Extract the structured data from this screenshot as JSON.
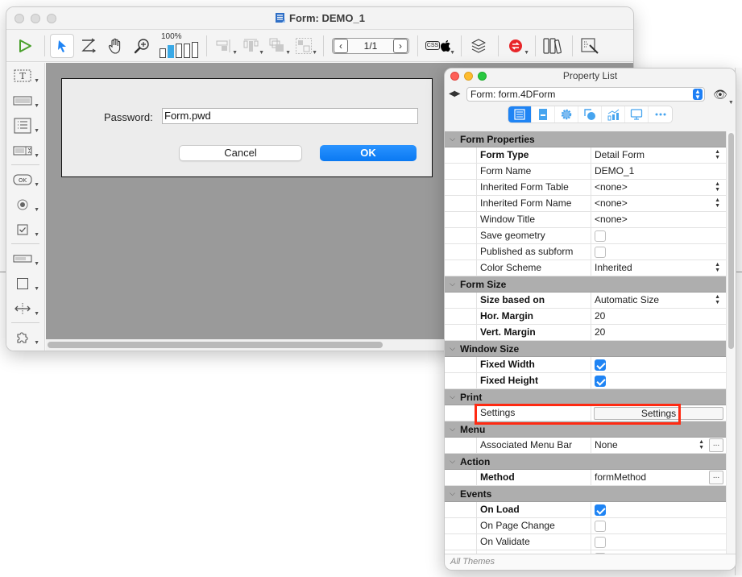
{
  "form_window": {
    "title": "Form: DEMO_1",
    "toolbar": {
      "zoom_label": "100%",
      "zoom_levels": 5,
      "zoom_active_index": 1,
      "page_indicator": "1/1",
      "css_badge": "CSS",
      "items": [
        {
          "name": "run-form",
          "icon": "play-icon"
        },
        {
          "name": "select-tool",
          "icon": "arrow-pointer-icon",
          "selected": true
        },
        {
          "name": "entry-order",
          "icon": "entry-order-icon"
        },
        {
          "name": "move-hand",
          "icon": "hand-icon"
        },
        {
          "name": "zoom-tool",
          "icon": "magnifier-plus-icon"
        },
        {
          "name": "align",
          "icon": "align-icon"
        },
        {
          "name": "distribute",
          "icon": "distribute-icon"
        },
        {
          "name": "level",
          "icon": "layer-order-icon"
        },
        {
          "name": "group",
          "icon": "group-icon"
        },
        {
          "name": "css-preview",
          "icon": "css-apple-icon"
        },
        {
          "name": "views",
          "icon": "layers-icon"
        },
        {
          "name": "shields",
          "icon": "shield-swap-icon"
        },
        {
          "name": "library",
          "icon": "library-icon"
        },
        {
          "name": "form-wizard",
          "icon": "wizard-icon"
        }
      ]
    },
    "palette": [
      {
        "name": "text",
        "icon": "text-tool-icon"
      },
      {
        "name": "input",
        "icon": "input-tool-icon"
      },
      {
        "name": "list",
        "icon": "list-tool-icon"
      },
      {
        "name": "combo",
        "icon": "combo-tool-icon"
      },
      {
        "name": "button",
        "icon": "button-tool-icon",
        "label": "OK"
      },
      {
        "name": "radio",
        "icon": "radio-tool-icon"
      },
      {
        "name": "checkbox",
        "icon": "checkbox-tool-icon"
      },
      {
        "name": "progress",
        "icon": "progress-tool-icon"
      },
      {
        "name": "rectangle",
        "icon": "rectangle-tool-icon"
      },
      {
        "name": "splitter",
        "icon": "splitter-tool-icon"
      },
      {
        "name": "plugin",
        "icon": "plugin-tool-icon"
      }
    ],
    "form": {
      "password_label": "Password:",
      "password_value": "Form.pwd",
      "cancel_label": "Cancel",
      "ok_label": "OK"
    }
  },
  "property_list": {
    "title": "Property List",
    "form_selector": "Form: form.4DForm",
    "tabs": [
      {
        "name": "tab-all",
        "icon": "list-icon",
        "active": true
      },
      {
        "name": "tab-form",
        "icon": "form-icon"
      },
      {
        "name": "tab-settings",
        "icon": "gear-icon"
      },
      {
        "name": "tab-objects",
        "icon": "objects-icon"
      },
      {
        "name": "tab-data",
        "icon": "chart-icon"
      },
      {
        "name": "tab-display",
        "icon": "monitor-icon"
      },
      {
        "name": "tab-more",
        "icon": "more-icon"
      }
    ],
    "sections": [
      {
        "title": "Form Properties",
        "rows": [
          {
            "label": "Form Type",
            "bold": true,
            "value": "Detail Form",
            "control": "popup"
          },
          {
            "label": "Form Name",
            "value": "DEMO_1",
            "control": "text"
          },
          {
            "label": "Inherited Form Table",
            "value": "<none>",
            "control": "popup"
          },
          {
            "label": "Inherited Form Name",
            "value": "<none>",
            "control": "popup"
          },
          {
            "label": "Window Title",
            "value": "<none>",
            "control": "text"
          },
          {
            "label": "Save geometry",
            "control": "checkbox",
            "checked": false
          },
          {
            "label": "Published as subform",
            "control": "checkbox",
            "checked": false
          },
          {
            "label": "Color Scheme",
            "value": "Inherited",
            "control": "popup"
          }
        ]
      },
      {
        "title": "Form Size",
        "rows": [
          {
            "label": "Size based on",
            "bold": true,
            "value": "Automatic Size",
            "control": "popup"
          },
          {
            "label": "Hor. Margin",
            "bold": true,
            "value": "20",
            "control": "text"
          },
          {
            "label": "Vert. Margin",
            "bold": true,
            "value": "20",
            "control": "text"
          }
        ]
      },
      {
        "title": "Window Size",
        "rows": [
          {
            "label": "Fixed Width",
            "bold": true,
            "control": "checkbox",
            "checked": true
          },
          {
            "label": "Fixed Height",
            "bold": true,
            "control": "checkbox",
            "checked": true
          }
        ]
      },
      {
        "title": "Print",
        "rows": [
          {
            "label": "Settings",
            "control": "button",
            "value": "Settings"
          }
        ]
      },
      {
        "title": "Menu",
        "rows": [
          {
            "label": "Associated Menu Bar",
            "value": "None",
            "control": "popup-ellipsis"
          }
        ]
      },
      {
        "title": "Action",
        "rows": [
          {
            "label": "Method",
            "bold": true,
            "value": "formMethod",
            "control": "text-ellipsis"
          }
        ]
      },
      {
        "title": "Events",
        "rows": [
          {
            "label": "On Load",
            "bold": true,
            "control": "checkbox",
            "checked": true
          },
          {
            "label": "On Page Change",
            "control": "checkbox",
            "checked": false
          },
          {
            "label": "On Validate",
            "control": "checkbox",
            "checked": false
          },
          {
            "label": "",
            "control": "checkbox",
            "checked": false
          }
        ]
      }
    ],
    "footer": "All Themes",
    "highlight_color": "#ff2a12",
    "accent_color": "#1f84f4"
  }
}
